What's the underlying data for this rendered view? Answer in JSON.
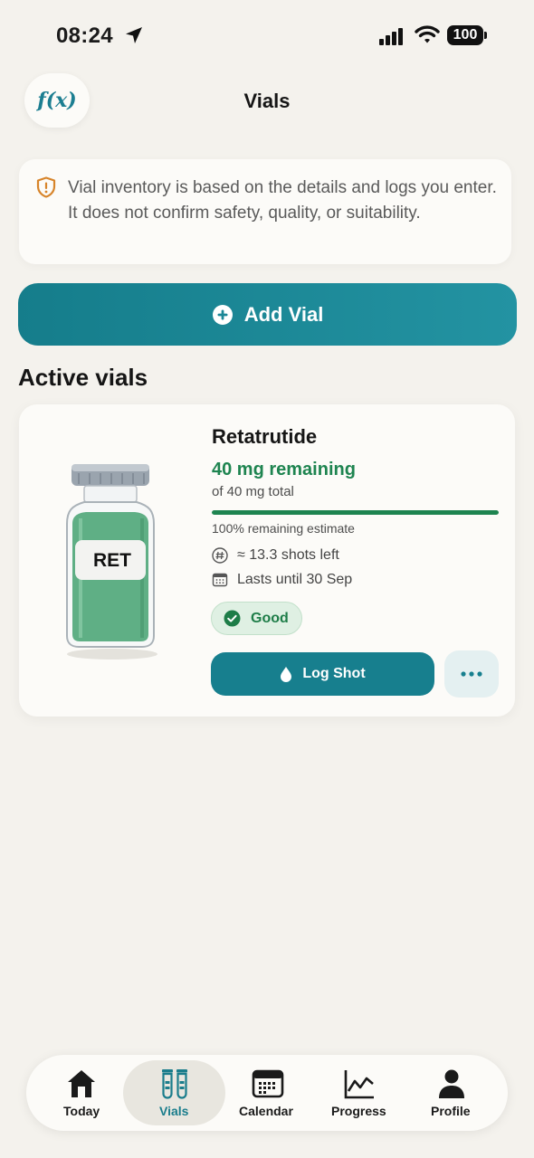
{
  "status_bar": {
    "time": "08:24",
    "battery": "100"
  },
  "header": {
    "fx_label": "f(x)",
    "title": "Vials"
  },
  "disclaimer": {
    "text": "Vial inventory is based on the details and logs you enter. It does not confirm safety, quality, or suitability."
  },
  "add_vial": {
    "label": "Add Vial"
  },
  "section": {
    "title": "Active vials"
  },
  "vial": {
    "label_code": "RET",
    "name": "Retatrutide",
    "remaining": "40 mg remaining",
    "total": "of 40 mg total",
    "remaining_fraction": 1.0,
    "estimate": "100% remaining estimate",
    "shots_left": "≈ 13.3 shots left",
    "lasts_until": "Lasts until 30 Sep",
    "status": "Good",
    "log_button": "Log Shot"
  },
  "colors": {
    "accent": "#177f8e",
    "success": "#1e8450",
    "background": "#f4f2ed"
  },
  "tabs": [
    {
      "label": "Today",
      "icon": "home-icon"
    },
    {
      "label": "Vials",
      "icon": "vials-icon",
      "active": true
    },
    {
      "label": "Calendar",
      "icon": "calendar-icon"
    },
    {
      "label": "Progress",
      "icon": "chart-icon"
    },
    {
      "label": "Profile",
      "icon": "person-icon"
    }
  ]
}
